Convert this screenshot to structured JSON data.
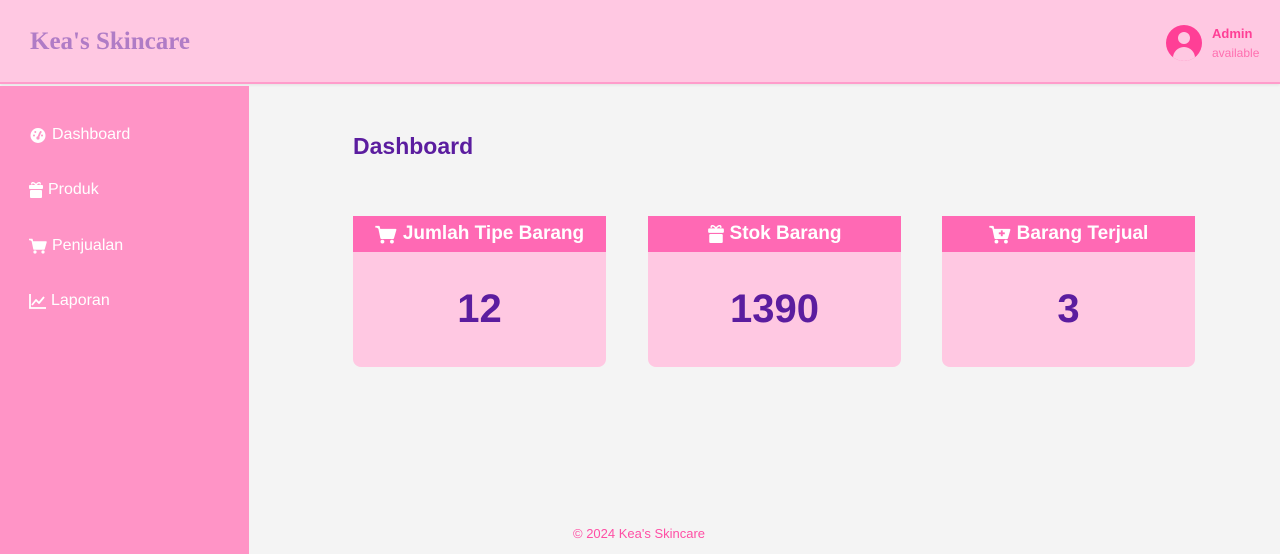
{
  "header": {
    "brand": "Kea's Skincare",
    "user": {
      "name": "Admin",
      "status": "available"
    }
  },
  "sidebar": {
    "items": [
      {
        "label": "Dashboard",
        "icon": "gauge-icon"
      },
      {
        "label": "Produk",
        "icon": "gift-icon"
      },
      {
        "label": "Penjualan",
        "icon": "cart-icon"
      },
      {
        "label": "Laporan",
        "icon": "line-chart-icon"
      }
    ]
  },
  "main": {
    "title": "Dashboard",
    "cards": [
      {
        "label": "Jumlah Tipe Barang",
        "value": "12",
        "icon": "cart-icon"
      },
      {
        "label": "Stok Barang",
        "value": "1390",
        "icon": "gift-icon"
      },
      {
        "label": "Barang Terjual",
        "value": "3",
        "icon": "cart-plus-icon"
      }
    ]
  },
  "footer": {
    "text": "© 2024 Kea's Skincare"
  },
  "colors": {
    "header_bg": "#ffc8e2",
    "sidebar_bg": "#ff94c6",
    "card_head_bg": "#ff69b4",
    "card_body_bg": "#ffc8e2",
    "accent_text": "#5b1d9f",
    "brand_text": "#b07cc6"
  }
}
